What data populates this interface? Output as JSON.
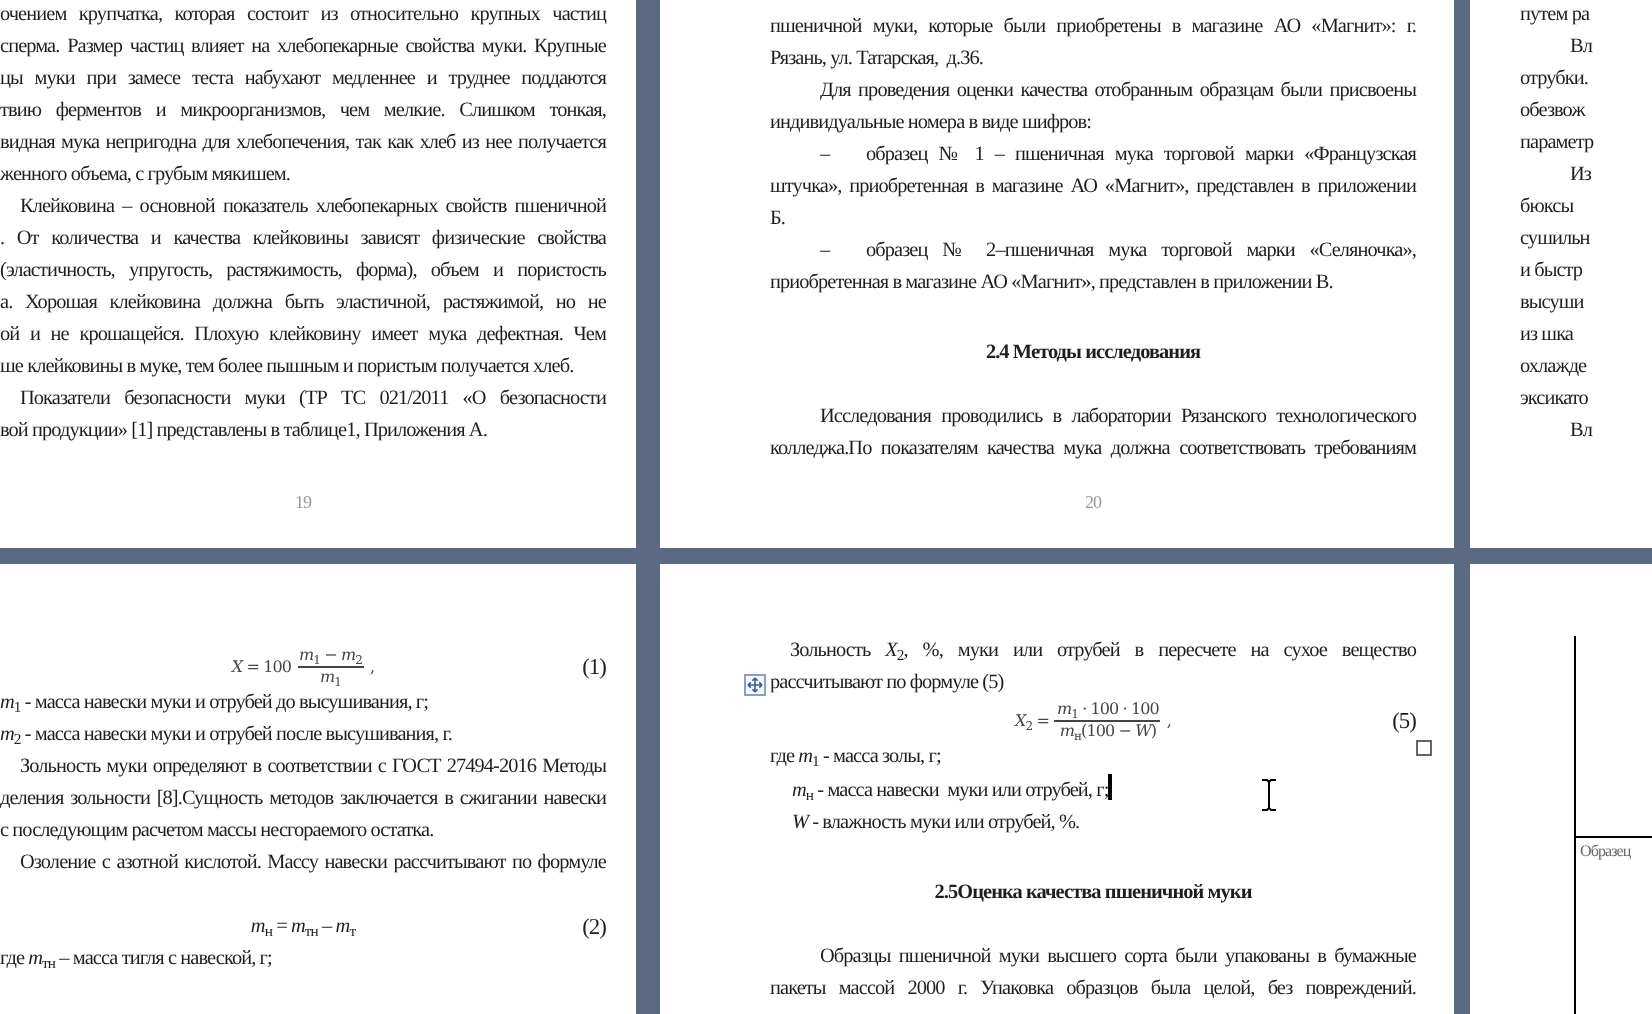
{
  "pages": [
    {
      "number": "19",
      "blocks": [
        {
          "kind": "line",
          "text": "очением крупчатка, которая состоит из относительно крупных частиц"
        },
        {
          "kind": "line",
          "text": "сперма. Размер частиц влияет на хлебопекарные свойства муки. Крупные"
        },
        {
          "kind": "line",
          "text": "цы муки при замесе теста набухают медленнее и труднее поддаются"
        },
        {
          "kind": "line",
          "text": "твию ферментов и микроорганизмов, чем мелкие. Слишком тонкая,"
        },
        {
          "kind": "line",
          "text": "видная мука непригодна для хлебопечения, так как хлеб из нее получается"
        },
        {
          "kind": "end",
          "text": "женного объема, с грубым мякишем."
        },
        {
          "kind": "lead",
          "text": "Клейковина – основной показатель хлебопекарных свойств пшеничной"
        },
        {
          "kind": "line",
          "text": ". От количества и качества клейковины зависят физические свойства"
        },
        {
          "kind": "line",
          "text": "(эластичность, упругость, растяжимость, форма), объем и пористость"
        },
        {
          "kind": "line",
          "text": "а. Хорошая клейковина должна быть эластичной, растяжимой, но не"
        },
        {
          "kind": "line",
          "text": "ой и не крошащейся. Плохую клейковину имеет мука дефектная. Чем"
        },
        {
          "kind": "end",
          "text": "ше клейковины в муке, тем более пышным и пористым получается хлеб."
        },
        {
          "kind": "lead",
          "text": "Показатели безопасности муки (ТР ТС 021/2011 «О безопасности"
        },
        {
          "kind": "end",
          "text": "вой продукции» [1] представлены в таблице1, Приложения А."
        }
      ]
    },
    {
      "number": "20",
      "blocks": [
        {
          "kind": "line",
          "text": "пшеничной муки, которые были приобретены в магазине АО «Магнит»: г."
        },
        {
          "kind": "end",
          "text": "Рязань, ул. Татарская,  д.36."
        },
        {
          "kind": "first",
          "text": "Для проведения оценки качества отобранным образцам были присвоены"
        },
        {
          "kind": "end",
          "text": "индивидуальные номера в виде шифров:"
        },
        {
          "kind": "list",
          "marker": "–",
          "text": "образец № 1 – пшеничная мука торговой марки «Французская"
        },
        {
          "kind": "line",
          "text": "штучка», приобретенная в магазине АО «Магнит», представлен в приложении"
        },
        {
          "kind": "end",
          "text": "Б."
        },
        {
          "kind": "list",
          "marker": "–",
          "text": "образец № 2–пшеничная мука торговой марки «Селяночка»,"
        },
        {
          "kind": "end",
          "text": "приобретенная в магазине АО «Магнит», представлен в приложении В."
        },
        {
          "kind": "heading",
          "text": "2.4 Методы исследования"
        },
        {
          "kind": "first",
          "text": "Исследования проводились в лаборатории Рязанского технологического"
        },
        {
          "kind": "line",
          "text": "колледжа.По показателям качества мука должна соответствовать требованиям"
        }
      ]
    },
    {
      "blocks": [
        {
          "kind": "end",
          "text": "путем ра"
        },
        {
          "kind": "indent",
          "text": "Вл"
        },
        {
          "kind": "end",
          "text": "отрубки."
        },
        {
          "kind": "end",
          "text": "обезвож"
        },
        {
          "kind": "end",
          "text": "параметр"
        },
        {
          "kind": "indent",
          "text": "Из"
        },
        {
          "kind": "end",
          "text": "бюксы"
        },
        {
          "kind": "end",
          "text": "сушильн"
        },
        {
          "kind": "end",
          "text": "и быстр"
        },
        {
          "kind": "end",
          "text": "высуши"
        },
        {
          "kind": "end",
          "text": "из шка"
        },
        {
          "kind": "end",
          "text": "охлажде"
        },
        {
          "kind": "end",
          "text": "эксикато"
        },
        {
          "kind": "indent",
          "text": "Вл"
        }
      ]
    },
    {
      "blocks": [
        {
          "kind": "formula",
          "lhs": "*X* = 100",
          "num": "*m*$_{1}$ − *m*$_{2}$",
          "den": "*m*$_{1}$",
          "after": ",",
          "tag": "(1)"
        },
        {
          "kind": "end",
          "text": "*m*$_{1}$ - масса навески муки и отрубей до высушивания, г;"
        },
        {
          "kind": "end",
          "text": "*m*$_{2}$ - масса навески муки и отрубей после высушивания, г."
        },
        {
          "kind": "lead",
          "text": "Зольность муки определяют в соответствии с ГОСТ 27494-2016 Методы"
        },
        {
          "kind": "line",
          "text": "деления зольности [8].Сущность методов заключается в сжигании навески"
        },
        {
          "kind": "end",
          "text": "с последующим расчетом массы несгораемого остатка."
        },
        {
          "kind": "lead",
          "text": "Озоление с азотной кислотой. Массу навески рассчитывают по формуле"
        },
        {
          "kind": "equation",
          "text": "*m*$_{н}$ = *m*$_{тн}$ – *m*$_{т}$",
          "tag": "(2)"
        },
        {
          "kind": "end",
          "text": "где *m*$_{тн}$ – масса тигля с навеской, г;"
        }
      ]
    },
    {
      "blocks": [
        {
          "kind": "lead",
          "text": "Зольность *X*$_{2}$, %, муки или отрубей в пересчете на сухое вещество"
        },
        {
          "kind": "end",
          "text": "рассчитывают по формуле (5)",
          "table_handle": true
        },
        {
          "kind": "formula",
          "lhs": "*X*$_{2}$ =",
          "num": "*m*$_{1}$ · 100 · 100",
          "den": "*m*$_{н}$(100 − *W*)",
          "after": ",",
          "tag": "(5)",
          "resize_handle": true
        },
        {
          "kind": "end",
          "text": "где *m*$_{1}$ - масса золы, г;"
        },
        {
          "kind": "note",
          "text": "*m*$_{н}$ - масса навески  муки или отрубей, г;",
          "caret": true
        },
        {
          "kind": "note",
          "text": "*W* - влажность муки или отрубей, %."
        },
        {
          "kind": "heading",
          "text": "2.5Оценка качества пшеничной муки"
        },
        {
          "kind": "first",
          "text": "Образцы пшеничной муки высшего сорта были упакованы в бумажные"
        },
        {
          "kind": "line",
          "text": "пакеты массой 2000 г. Упаковка образцов была целой, без повреждений."
        }
      ]
    },
    {
      "blocks": [
        {
          "kind": "table",
          "text": "Образец"
        }
      ]
    }
  ]
}
